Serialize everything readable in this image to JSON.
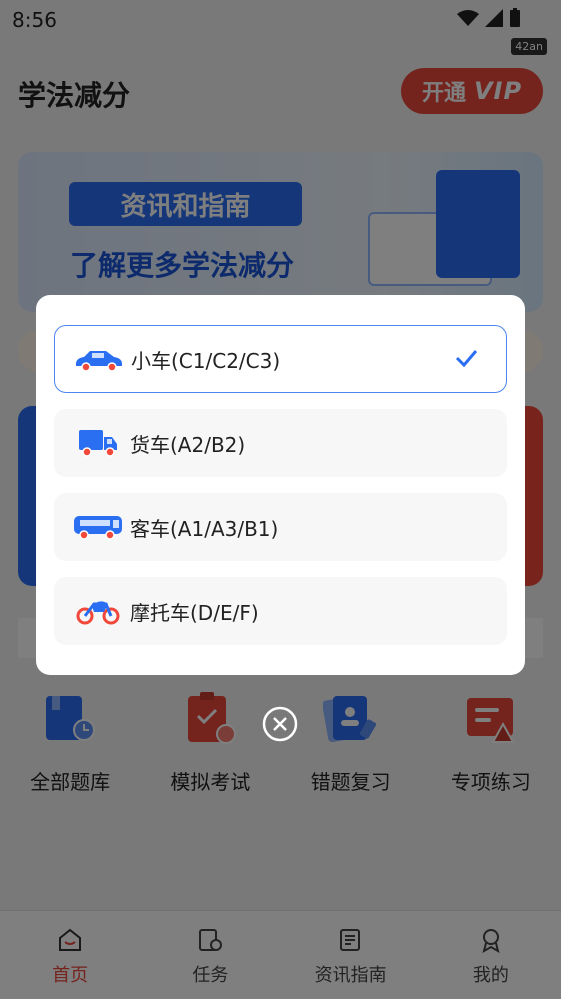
{
  "status_bar": {
    "time": "8:56",
    "badge": "42an"
  },
  "header": {
    "app_title": "学法减分",
    "vip_button": "开通",
    "vip_text": "VIP"
  },
  "banner": {
    "tag": "资讯和指南",
    "subtitle": "了解更多学法减分"
  },
  "shortcuts": [
    {
      "label": "全部题库",
      "icon": "question-bank-icon",
      "color": "#2a6ef2"
    },
    {
      "label": "模拟考试",
      "icon": "mock-exam-icon",
      "color": "#e8473a"
    },
    {
      "label": "错题复习",
      "icon": "wrong-review-icon",
      "color": "#2a6ef2"
    },
    {
      "label": "专项练习",
      "icon": "special-practice-icon",
      "color": "#e8473a"
    }
  ],
  "tabbar": {
    "items": [
      {
        "label": "首页",
        "icon": "home-icon",
        "active": true
      },
      {
        "label": "任务",
        "icon": "task-icon",
        "active": false
      },
      {
        "label": "资讯指南",
        "icon": "news-icon",
        "active": false
      },
      {
        "label": "我的",
        "icon": "profile-icon",
        "active": false
      }
    ]
  },
  "vehicle_dialog": {
    "options": [
      {
        "label": "小车(C1/C2/C3)",
        "icon": "car-icon",
        "selected": true
      },
      {
        "label": "货车(A2/B2)",
        "icon": "truck-icon",
        "selected": false
      },
      {
        "label": "客车(A1/A3/B1)",
        "icon": "bus-icon",
        "selected": false
      },
      {
        "label": "摩托车(D/E/F)",
        "icon": "motorcycle-icon",
        "selected": false
      }
    ]
  },
  "colors": {
    "accent_blue": "#2a6ef2",
    "accent_red": "#e8473a",
    "select_border": "#4b86f0"
  }
}
